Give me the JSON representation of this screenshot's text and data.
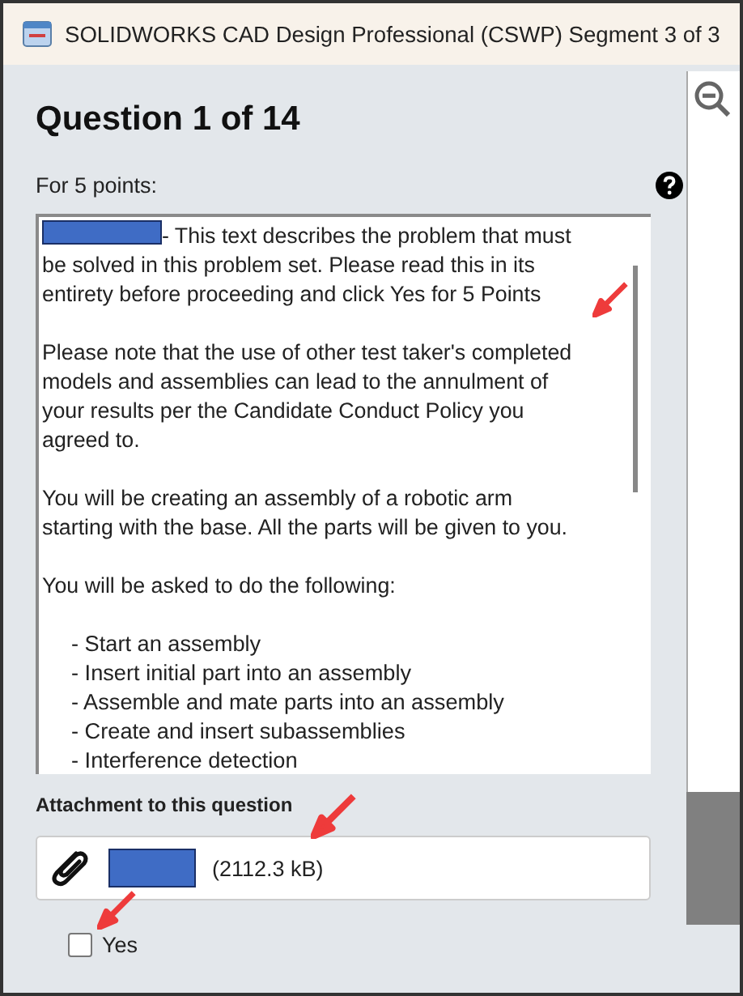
{
  "window": {
    "title": "SOLIDWORKS CAD Design Professional (CSWP) Segment 3 of 3"
  },
  "question": {
    "heading": "Question 1 of 14",
    "points": "For 5 points:"
  },
  "description": {
    "paragraphs": [
      "- This text describes the problem that must be solved in this problem set.  Please read this in its entirety before proceeding and click Yes for 5 Points",
      "Please note that the use of other test taker's completed models and assemblies can lead to the annulment of your results per the Candidate Conduct Policy you agreed to.",
      "You will be creating an assembly of a robotic arm starting with the base.  All the parts will be given to you.",
      "You will be asked to do the following:"
    ],
    "steps": [
      "- Start an assembly",
      "- Insert initial part into an assembly",
      "- Assemble and mate parts into an assembly",
      "- Create and insert subassemblies",
      "- Interference detection"
    ]
  },
  "attachment": {
    "label": "Attachment to this question",
    "size": "(2112.3 kB)"
  },
  "answer": {
    "label": "Yes",
    "checked": false
  }
}
